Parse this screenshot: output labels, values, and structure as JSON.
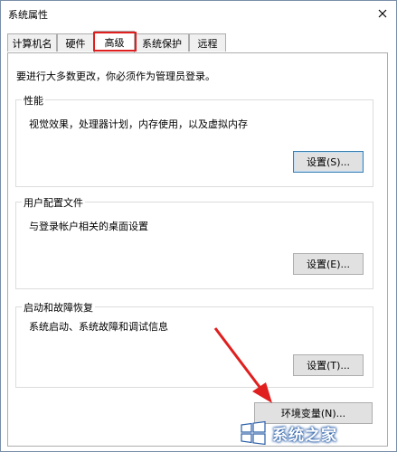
{
  "window": {
    "title": "系统属性"
  },
  "tabs": [
    {
      "label": "计算机名",
      "active": false
    },
    {
      "label": "硬件",
      "active": false
    },
    {
      "label": "高级",
      "active": true
    },
    {
      "label": "系统保护",
      "active": false
    },
    {
      "label": "远程",
      "active": false
    }
  ],
  "admin_note": "要进行大多数更改，你必须作为管理员登录。",
  "performance": {
    "title": "性能",
    "description": "视觉效果，处理器计划，内存使用，以及虚拟内存",
    "settings_button": "设置(S)..."
  },
  "user_profiles": {
    "title": "用户配置文件",
    "description": "与登录帐户相关的桌面设置",
    "settings_button": "设置(E)..."
  },
  "startup_recovery": {
    "title": "启动和故障恢复",
    "description": "系统启动、系统故障和调试信息",
    "settings_button": "设置(T)..."
  },
  "env_button": "环境变量(N)...",
  "watermark": {
    "text": "系统之家",
    "logo": "windows-logo"
  },
  "colors": {
    "highlight": "#e01f1f",
    "arrow": "#e01f1f",
    "accent": "#3c7fb1"
  }
}
